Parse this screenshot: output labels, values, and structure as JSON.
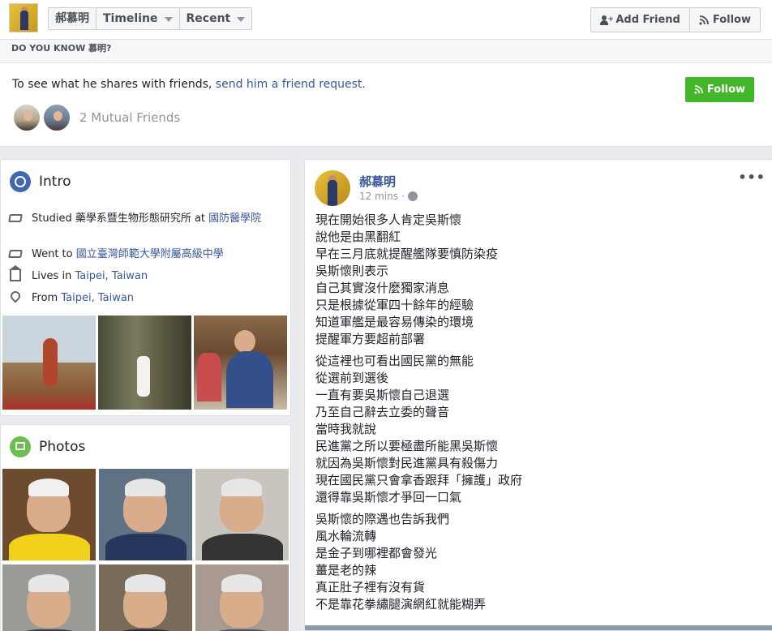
{
  "nav": {
    "profile_name": "郝慕明",
    "timeline_label": "Timeline",
    "recent_label": "Recent",
    "add_friend_label": "Add Friend",
    "follow_label": "Follow"
  },
  "do_you_know": {
    "heading": "DO YOU KNOW 慕明?",
    "message_prefix": "To see what he shares with friends, ",
    "message_link": "send him a friend request.",
    "mutual_friends": "2 Mutual Friends",
    "follow_button": "Follow"
  },
  "intro": {
    "title": "Intro",
    "items": [
      {
        "icon": "graduation-cap-icon",
        "prefix": "Studied 藥學系暨生物形態研究所 at ",
        "link": "國防醫學院"
      },
      {
        "icon": "graduation-cap-icon",
        "prefix": "Went to ",
        "link": "國立臺灣師範大學附屬高級中學"
      },
      {
        "icon": "home-icon",
        "prefix": "Lives in ",
        "link": "Taipei, Taiwan"
      },
      {
        "icon": "location-pin-icon",
        "prefix": "From ",
        "link": "Taipei, Taiwan"
      }
    ]
  },
  "photos": {
    "title": "Photos"
  },
  "post": {
    "author": "郝慕明",
    "time": "12 mins",
    "separator": "·",
    "paragraphs": [
      [
        "現在開始很多人肯定吳斯懷",
        "說他是由黑翻紅",
        "早在三月底就提醒艦隊要慎防染疫",
        "吳斯懷則表示",
        "自己其實沒什麼獨家消息",
        "只是根據從軍四十餘年的經驗",
        "知道軍艦是最容易傳染的環境",
        "提醒軍方要超前部署"
      ],
      [
        "從這裡也可看出國民黨的無能",
        "從選前到選後",
        "一直有要吳斯懷自己退選",
        "乃至自己辭去立委的聲音",
        "當時我就說",
        "民進黨之所以要極盡所能黑吳斯懷",
        "就因為吳斯懷對民進黨具有殺傷力",
        "現在國民黨只會拿香跟拜「擁護」政府",
        "還得靠吳斯懷才爭回一口氣"
      ],
      [
        "吳斯懷的際遇也告訴我們",
        "風水輪流轉",
        "是金子到哪裡都會發光",
        "薑是老的辣",
        "真正肚子裡有沒有貨",
        "不是靠花拳繡腿演網紅就能糊弄"
      ]
    ]
  }
}
